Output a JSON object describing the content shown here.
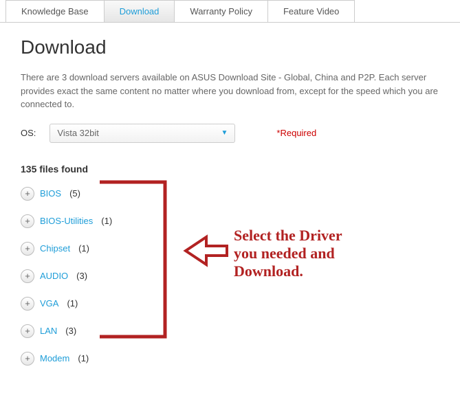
{
  "tabs": [
    {
      "label": "Knowledge Base",
      "active": false
    },
    {
      "label": "Download",
      "active": true
    },
    {
      "label": "Warranty Policy",
      "active": false
    },
    {
      "label": "Feature Video",
      "active": false
    }
  ],
  "page_title": "Download",
  "description": "There are 3 download servers available on ASUS Download Site - Global, China and P2P. Each server provides exact the same content no matter where you download from, except for the speed which you are connected to.",
  "os_label": "OS:",
  "os_selected": "Vista 32bit",
  "required_label": "*Required",
  "files_found": "135 files found",
  "categories": [
    {
      "name": "BIOS",
      "count": "(5)"
    },
    {
      "name": "BIOS-Utilities",
      "count": "(1)"
    },
    {
      "name": "Chipset",
      "count": "(1)"
    },
    {
      "name": "AUDIO",
      "count": "(3)"
    },
    {
      "name": "VGA",
      "count": "(1)"
    },
    {
      "name": "LAN",
      "count": "(3)"
    },
    {
      "name": "Modem",
      "count": "(1)"
    }
  ],
  "annotation_text": "Select the Driver you needed and Download.",
  "annotation_color": "#b22222"
}
